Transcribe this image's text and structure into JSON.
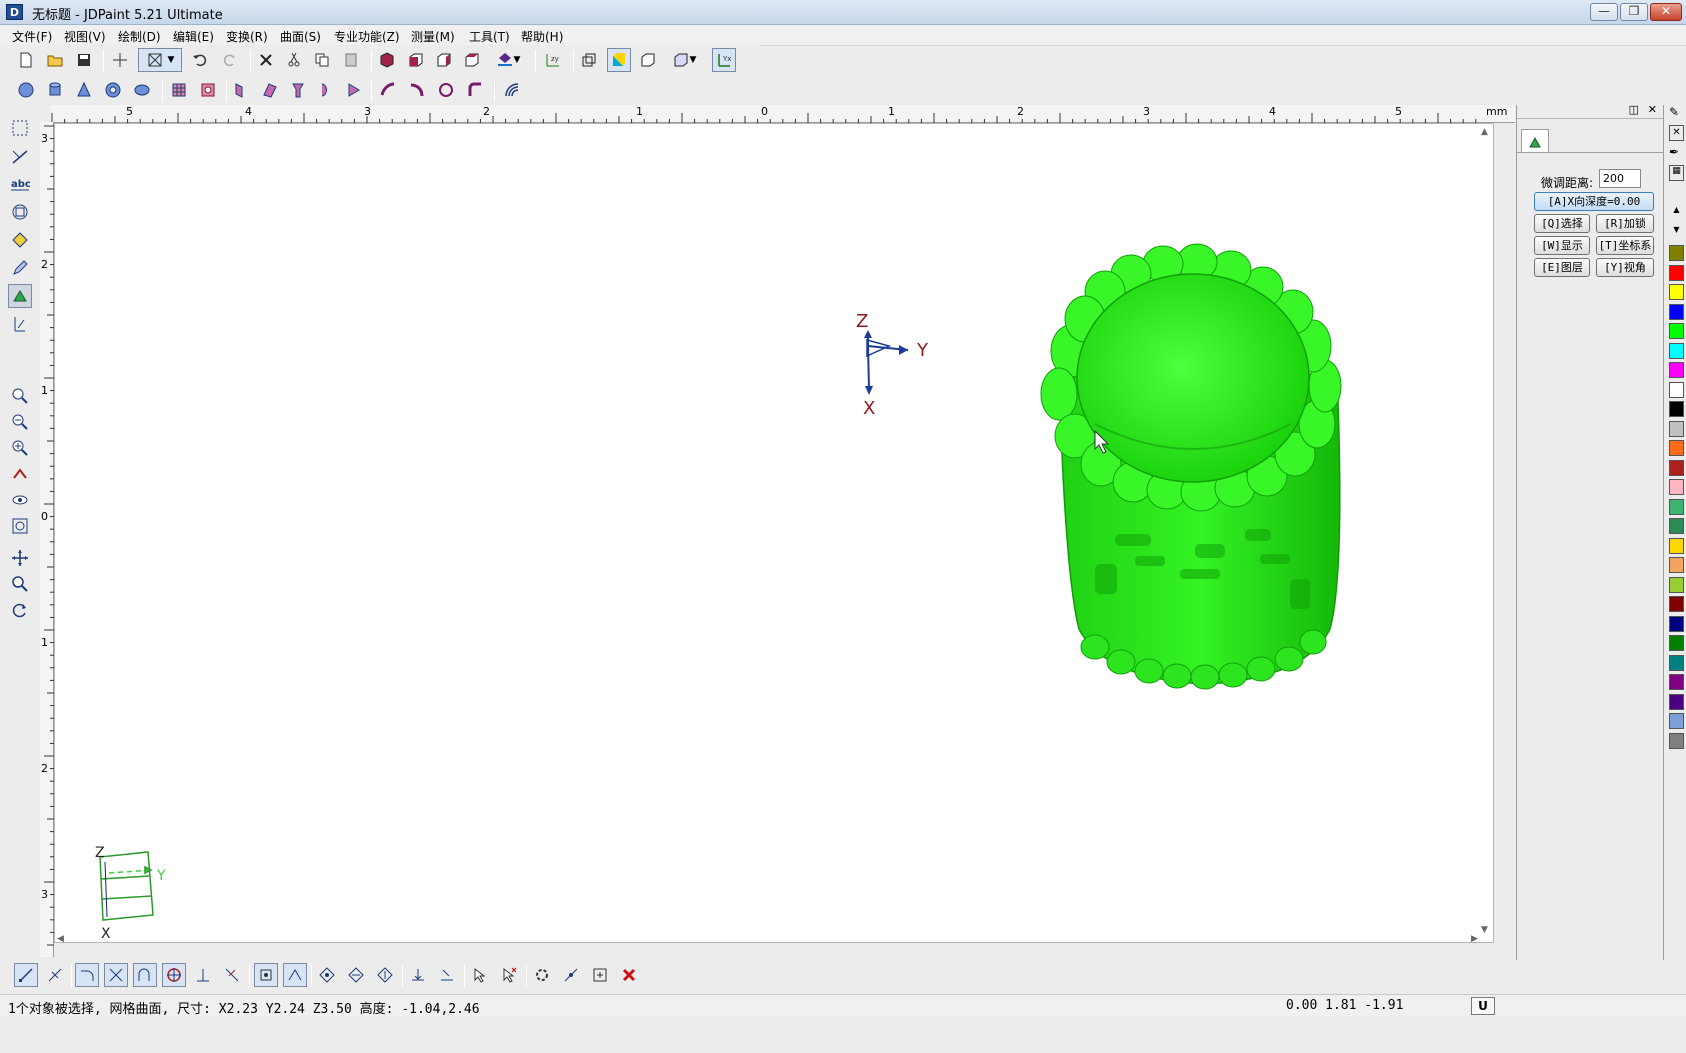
{
  "window": {
    "title": "无标题 - JDPaint 5.21 Ultimate",
    "logo_letter": "D",
    "minimize": "—",
    "restore": "❐",
    "close": "✕"
  },
  "menu": [
    "文件(F)",
    "视图(V)",
    "绘制(D)",
    "编辑(E)",
    "变换(R)",
    "曲面(S)",
    "专业功能(Z)",
    "测量(M)",
    "工具(T)",
    "帮助(H)"
  ],
  "ruler": {
    "unit": "mm",
    "h_labels": [
      "5",
      "4",
      "3",
      "2",
      "1",
      "0",
      "1",
      "2",
      "3",
      "4",
      "5"
    ],
    "v_labels": [
      "3",
      "2",
      "1",
      "0",
      "1",
      "2",
      "3"
    ]
  },
  "axes": {
    "center_label_z": "Z",
    "center_label_y": "Y",
    "center_label_x": "X",
    "corner_label_z": "Z",
    "corner_label_y": "Y",
    "corner_label_x": "X"
  },
  "model": {
    "color": "#22ee11",
    "shade": "#13a80a"
  },
  "right_panel": {
    "fine_tune_label": "微调距离:",
    "fine_tune_value": "200",
    "depth_button": "[A]X向深度=0.00",
    "buttons": [
      "[Q]选择",
      "[R]加锁",
      "[W]显示",
      "[T]坐标系",
      "[E]图层",
      "[Y]视角"
    ]
  },
  "palette": [
    "#808000",
    "#ff0000",
    "#ffff00",
    "#0000ff",
    "#00ff00",
    "#00ffff",
    "#ff00ff",
    "#ffffff",
    "#000000",
    "#c0c0c0",
    "#ff6a1a",
    "#b01f1f",
    "#ffb6c1",
    "#3cb371",
    "#2e8b57",
    "#ffd700",
    "#f4a460",
    "#9acd32",
    "#800000",
    "#000080",
    "#008000",
    "#008080",
    "#800080",
    "#4b0082",
    "#7b9fd6",
    "#808080"
  ],
  "status": {
    "message": "1个对象被选择, 网格曲面, 尺寸: X2.23 Y2.24 Z3.50 高度: -1.04,2.46",
    "coords": "0.00 1.81 -1.91",
    "unit_button": "U"
  }
}
